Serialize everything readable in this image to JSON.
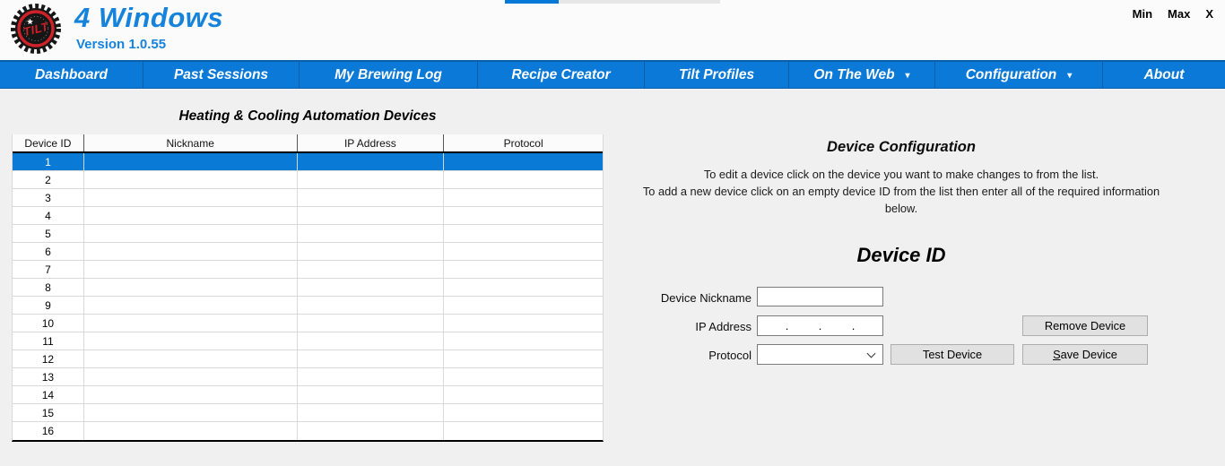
{
  "window": {
    "controls": {
      "minimize": "Min",
      "maximize": "Max",
      "close": "X"
    },
    "progress": {
      "percent": 25
    }
  },
  "header": {
    "title": "4 Windows",
    "version": "Version 1.0.55",
    "logo_text": "TILT"
  },
  "nav": {
    "items": [
      {
        "label": "Dashboard",
        "has_dropdown": false
      },
      {
        "label": "Past Sessions",
        "has_dropdown": false
      },
      {
        "label": "My Brewing Log",
        "has_dropdown": false
      },
      {
        "label": "Recipe Creator",
        "has_dropdown": false
      },
      {
        "label": "Tilt Profiles",
        "has_dropdown": false
      },
      {
        "label": "On The Web",
        "has_dropdown": true
      },
      {
        "label": "Configuration",
        "has_dropdown": true
      },
      {
        "label": "About",
        "has_dropdown": false
      }
    ],
    "dropdown_caret": "▾"
  },
  "devices_table": {
    "title": "Heating & Cooling Automation Devices",
    "columns": [
      "Device ID",
      "Nickname",
      "IP Address",
      "Protocol"
    ],
    "selected_device_id": "1",
    "rows": [
      {
        "id": "1",
        "nickname": "",
        "ip_address": "",
        "protocol": ""
      },
      {
        "id": "2",
        "nickname": "",
        "ip_address": "",
        "protocol": ""
      },
      {
        "id": "3",
        "nickname": "",
        "ip_address": "",
        "protocol": ""
      },
      {
        "id": "4",
        "nickname": "",
        "ip_address": "",
        "protocol": ""
      },
      {
        "id": "5",
        "nickname": "",
        "ip_address": "",
        "protocol": ""
      },
      {
        "id": "6",
        "nickname": "",
        "ip_address": "",
        "protocol": ""
      },
      {
        "id": "7",
        "nickname": "",
        "ip_address": "",
        "protocol": ""
      },
      {
        "id": "8",
        "nickname": "",
        "ip_address": "",
        "protocol": ""
      },
      {
        "id": "9",
        "nickname": "",
        "ip_address": "",
        "protocol": ""
      },
      {
        "id": "10",
        "nickname": "",
        "ip_address": "",
        "protocol": ""
      },
      {
        "id": "11",
        "nickname": "",
        "ip_address": "",
        "protocol": ""
      },
      {
        "id": "12",
        "nickname": "",
        "ip_address": "",
        "protocol": ""
      },
      {
        "id": "13",
        "nickname": "",
        "ip_address": "",
        "protocol": ""
      },
      {
        "id": "14",
        "nickname": "",
        "ip_address": "",
        "protocol": ""
      },
      {
        "id": "15",
        "nickname": "",
        "ip_address": "",
        "protocol": ""
      },
      {
        "id": "16",
        "nickname": "",
        "ip_address": "",
        "protocol": ""
      }
    ]
  },
  "device_config": {
    "heading": "Device Configuration",
    "instructions": [
      "To edit a device click on the device you want to make changes to from the list.",
      "To add a new device click on an empty device ID from the list then enter all of the required information below."
    ],
    "device_id_heading": "Device ID",
    "fields": {
      "device_nickname": {
        "label": "Device Nickname",
        "value": ""
      },
      "ip_address": {
        "label": "IP Address",
        "value": "",
        "mask_dots": [
          ".",
          ".",
          "."
        ]
      },
      "protocol": {
        "label": "Protocol",
        "value": ""
      }
    },
    "buttons": {
      "remove": "Remove Device",
      "test": "Test Device",
      "save": "Save Device"
    }
  },
  "colors": {
    "nav_blue": "#0a79d8",
    "title_blue": "#1583dc",
    "selection_blue": "#0a7ad7",
    "progress_blue": "#0078d7",
    "logo_red": "#cf2128"
  }
}
